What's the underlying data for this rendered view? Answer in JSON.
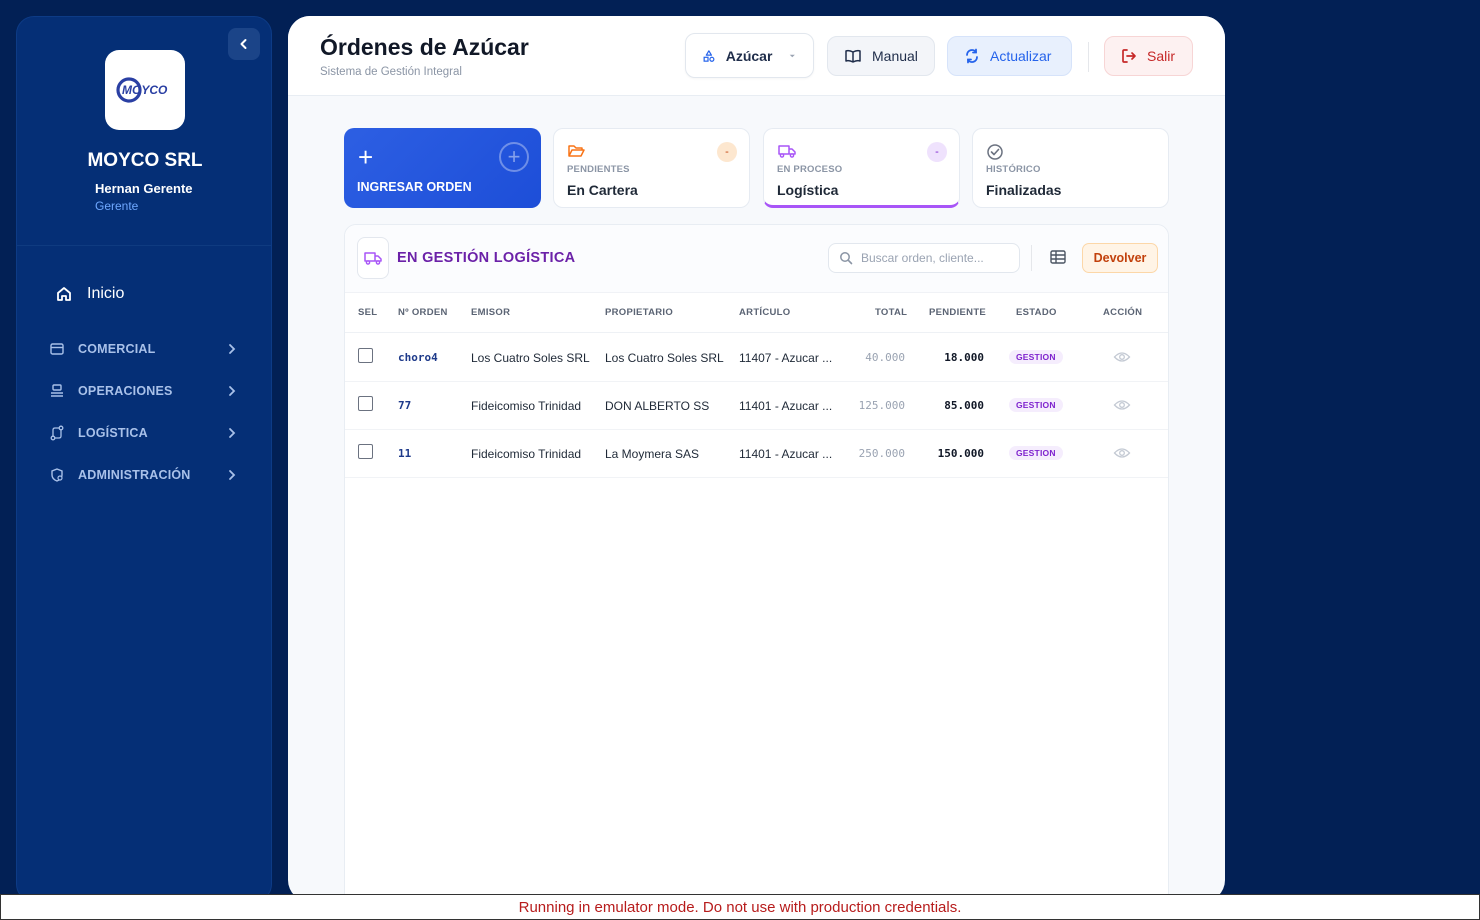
{
  "sidebar": {
    "company": "MOYCO SRL",
    "logo_text": "MOYCO",
    "user_name": "Hernan Gerente",
    "user_role": "Gerente",
    "home_label": "Inicio",
    "items": [
      {
        "label": "COMERCIAL",
        "icon": "store-icon"
      },
      {
        "label": "OPERACIONES",
        "icon": "operations-icon"
      },
      {
        "label": "LOGÍSTICA",
        "icon": "route-icon"
      },
      {
        "label": "ADMINISTRACIÓN",
        "icon": "admin-icon"
      }
    ]
  },
  "header": {
    "title": "Órdenes de Azúcar",
    "subtitle": "Sistema de Gestión Integral",
    "product_label": "Azúcar",
    "manual_label": "Manual",
    "refresh_label": "Actualizar",
    "exit_label": "Salir"
  },
  "cards": {
    "new_order": "INGRESAR ORDEN",
    "pending": {
      "caption": "PENDIENTES",
      "title": "En Cartera",
      "badge": "-"
    },
    "in_process": {
      "caption": "EN PROCESO",
      "title": "Logística",
      "badge": "-"
    },
    "history": {
      "caption": "HISTÓRICO",
      "title": "Finalizadas"
    }
  },
  "panel": {
    "title": "EN GESTIÓN LOGÍSTICA",
    "search_placeholder": "Buscar orden, cliente...",
    "return_label": "Devolver"
  },
  "table": {
    "headers": {
      "sel": "SEL",
      "order": "Nº ORDEN",
      "issuer": "EMISOR",
      "owner": "PROPIETARIO",
      "article": "ARTÍCULO",
      "total": "TOTAL",
      "pending": "PENDIENTE",
      "status": "ESTADO",
      "action": "ACCIÓN"
    },
    "rows": [
      {
        "order": "choro4",
        "issuer": "Los Cuatro Soles SRL",
        "owner": "Los Cuatro Soles SRL",
        "article": "11407 - Azucar ...",
        "total": "40.000",
        "pending": "18.000",
        "status": "GESTION"
      },
      {
        "order": "77",
        "issuer": "Fideicomiso Trinidad",
        "owner": "DON ALBERTO SS",
        "article": "11401 - Azucar ...",
        "total": "125.000",
        "pending": "85.000",
        "status": "GESTION"
      },
      {
        "order": "11",
        "issuer": "Fideicomiso Trinidad",
        "owner": "La Moymera SAS",
        "article": "11401 - Azucar ...",
        "total": "250.000",
        "pending": "150.000",
        "status": "GESTION"
      }
    ]
  },
  "banner": "Running in emulator mode. Do not use with production credentials.",
  "colors": {
    "background": "#022055",
    "sidebar": "#052f76",
    "accent_blue": "#2563eb",
    "logistics_purple": "#a855f7",
    "danger": "#c62828"
  }
}
